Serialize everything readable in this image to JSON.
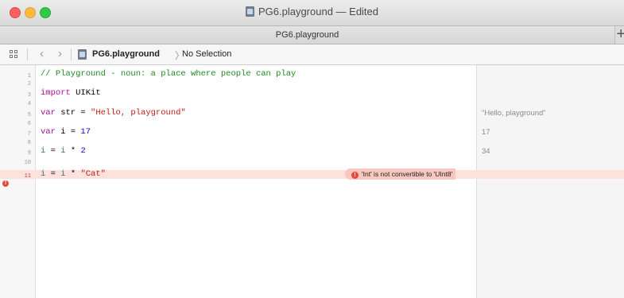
{
  "window": {
    "title": "PG6.playground — Edited"
  },
  "tabbar": {
    "tab_label": "PG6.playground",
    "add_tab": "+"
  },
  "jumpbar": {
    "file": "PG6.playground",
    "separator": "〉",
    "selection": "No Selection"
  },
  "code_lines": [
    {
      "n": "1",
      "segments": [
        {
          "t": "// Playground - noun: a place where people can play",
          "c": "comment"
        }
      ]
    },
    {
      "n": "2",
      "segments": []
    },
    {
      "n": "3",
      "segments": [
        {
          "t": "import",
          "c": "kw"
        },
        {
          "t": " UIKit",
          "c": ""
        }
      ]
    },
    {
      "n": "4",
      "segments": []
    },
    {
      "n": "5",
      "segments": [
        {
          "t": "var",
          "c": "kw"
        },
        {
          "t": " str = ",
          "c": ""
        },
        {
          "t": "\"Hello, playground\"",
          "c": "str"
        }
      ]
    },
    {
      "n": "6",
      "segments": []
    },
    {
      "n": "7",
      "segments": [
        {
          "t": "var",
          "c": "kw"
        },
        {
          "t": " i = ",
          "c": ""
        },
        {
          "t": "17",
          "c": "num"
        }
      ]
    },
    {
      "n": "8",
      "segments": []
    },
    {
      "n": "9",
      "segments": [
        {
          "t": "i",
          "c": "ident"
        },
        {
          "t": " = ",
          "c": ""
        },
        {
          "t": "i",
          "c": "ident"
        },
        {
          "t": " * ",
          "c": ""
        },
        {
          "t": "2",
          "c": "num"
        }
      ]
    },
    {
      "n": "10",
      "segments": []
    },
    {
      "n": "11",
      "segments": [
        {
          "t": "i",
          "c": "ident"
        },
        {
          "t": " = ",
          "c": ""
        },
        {
          "t": "i",
          "c": "ident"
        },
        {
          "t": " * ",
          "c": ""
        },
        {
          "t": "\"Cat\"",
          "c": "str"
        }
      ],
      "error": true
    }
  ],
  "error_message": "'Int' is not convertible to 'UInt8'",
  "results": [
    {
      "line": "5",
      "value": "\"Hello, playground\""
    },
    {
      "line": "7",
      "value": "17"
    },
    {
      "line": "9",
      "value": "34"
    }
  ],
  "colors": {
    "comment": "#1c8a22",
    "keyword": "#aa0d91",
    "string": "#c41a16",
    "number": "#1c00cf",
    "error_bg": "#fce1dd",
    "error_badge": "#e8473b"
  },
  "icons": {
    "close": "close-button",
    "minimize": "minimize-button",
    "zoom": "zoom-button",
    "related_items": "grid-icon",
    "back": "chevron-left-icon",
    "forward": "chevron-right-icon",
    "playground_file": "playground-file-icon",
    "error": "error-icon"
  }
}
